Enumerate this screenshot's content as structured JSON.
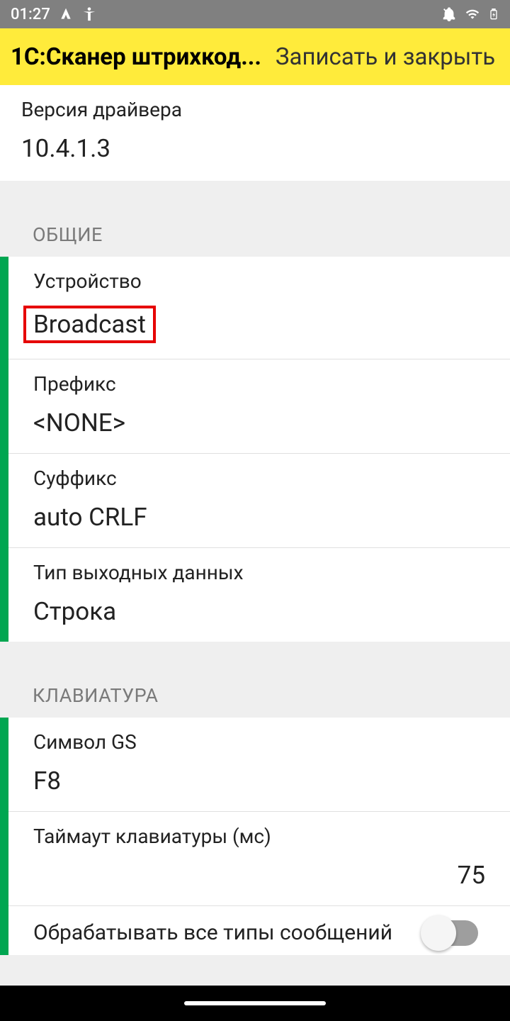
{
  "status": {
    "time": "01:27"
  },
  "header": {
    "title": "1С:Сканер штрихкод...",
    "action": "Записать и закрыть"
  },
  "driver": {
    "label": "Версия драйвера",
    "value": "10.4.1.3"
  },
  "sections": {
    "general": {
      "title": "ОБЩИЕ",
      "device": {
        "label": "Устройство",
        "value": "Broadcast"
      },
      "prefix": {
        "label": "Префикс",
        "value": "<NONE>"
      },
      "suffix": {
        "label": "Суффикс",
        "value": "auto CRLF"
      },
      "output_type": {
        "label": "Тип выходных данных",
        "value": "Строка"
      }
    },
    "keyboard": {
      "title": "КЛАВИАТУРА",
      "gs_symbol": {
        "label": "Символ GS",
        "value": "F8"
      },
      "timeout": {
        "label": "Таймаут клавиатуры (мс)",
        "value": "75"
      },
      "process_all": {
        "label": "Обрабатывать все типы сообщений"
      }
    }
  }
}
